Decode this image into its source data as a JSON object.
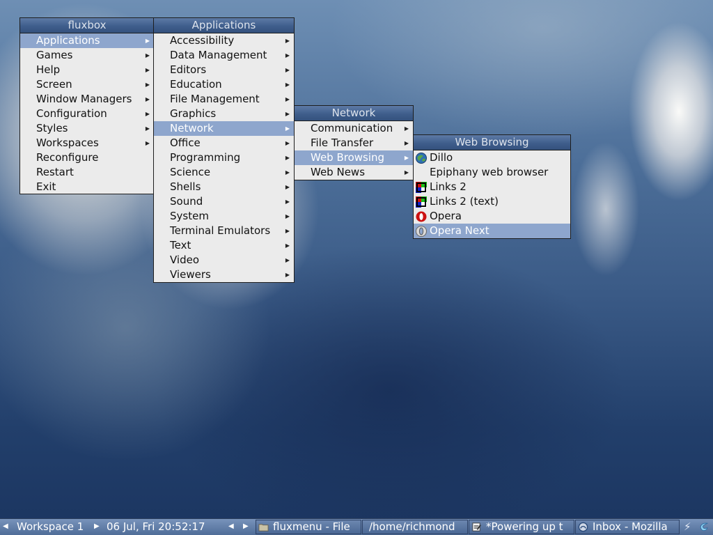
{
  "root_menu": {
    "title": "fluxbox",
    "items": [
      {
        "label": "Applications",
        "submenu": true
      },
      {
        "label": "Games",
        "submenu": true
      },
      {
        "label": "Help",
        "submenu": true
      },
      {
        "label": "Screen",
        "submenu": true
      },
      {
        "label": "Window Managers",
        "submenu": true
      },
      {
        "label": "Configuration",
        "submenu": true
      },
      {
        "label": "Styles",
        "submenu": true
      },
      {
        "label": "Workspaces",
        "submenu": true
      },
      {
        "label": "Reconfigure",
        "submenu": false
      },
      {
        "label": "Restart",
        "submenu": false
      },
      {
        "label": "Exit",
        "submenu": false
      }
    ]
  },
  "applications_menu": {
    "title": "Applications",
    "items": [
      {
        "label": "Accessibility"
      },
      {
        "label": "Data Management"
      },
      {
        "label": "Editors"
      },
      {
        "label": "Education"
      },
      {
        "label": "File Management"
      },
      {
        "label": "Graphics"
      },
      {
        "label": "Network"
      },
      {
        "label": "Office"
      },
      {
        "label": "Programming"
      },
      {
        "label": "Science"
      },
      {
        "label": "Shells"
      },
      {
        "label": "Sound"
      },
      {
        "label": "System"
      },
      {
        "label": "Terminal Emulators"
      },
      {
        "label": "Text"
      },
      {
        "label": "Video"
      },
      {
        "label": "Viewers"
      }
    ]
  },
  "network_menu": {
    "title": "Network",
    "items": [
      {
        "label": "Communication"
      },
      {
        "label": "File Transfer"
      },
      {
        "label": "Web Browsing"
      },
      {
        "label": "Web News"
      }
    ]
  },
  "web_browsing_menu": {
    "title": "Web Browsing",
    "items": [
      {
        "label": "Dillo",
        "icon": "dillo-icon"
      },
      {
        "label": "Epiphany web browser",
        "icon": ""
      },
      {
        "label": "Links 2",
        "icon": "links-icon"
      },
      {
        "label": "Links 2 (text)",
        "icon": "links-icon"
      },
      {
        "label": "Opera",
        "icon": "opera-icon"
      },
      {
        "label": "Opera Next",
        "icon": "opera-next-icon"
      }
    ]
  },
  "taskbar": {
    "workspace": "Workspace 1",
    "clock": "06 Jul, Fri 20:52:17",
    "tasks": [
      {
        "label": "fluxmenu - File",
        "icon": "folder-icon"
      },
      {
        "label": "/home/richmond",
        "icon": ""
      },
      {
        "label": "*Powering up t",
        "icon": "editor-icon"
      },
      {
        "label": "Inbox - Mozilla",
        "icon": "mail-icon"
      }
    ]
  },
  "colors": {
    "menu_bg": "#ebebeb",
    "title_bg": "#3f5e8c",
    "highlight": "#8ea6cd",
    "taskbar": "#5b78a3"
  }
}
